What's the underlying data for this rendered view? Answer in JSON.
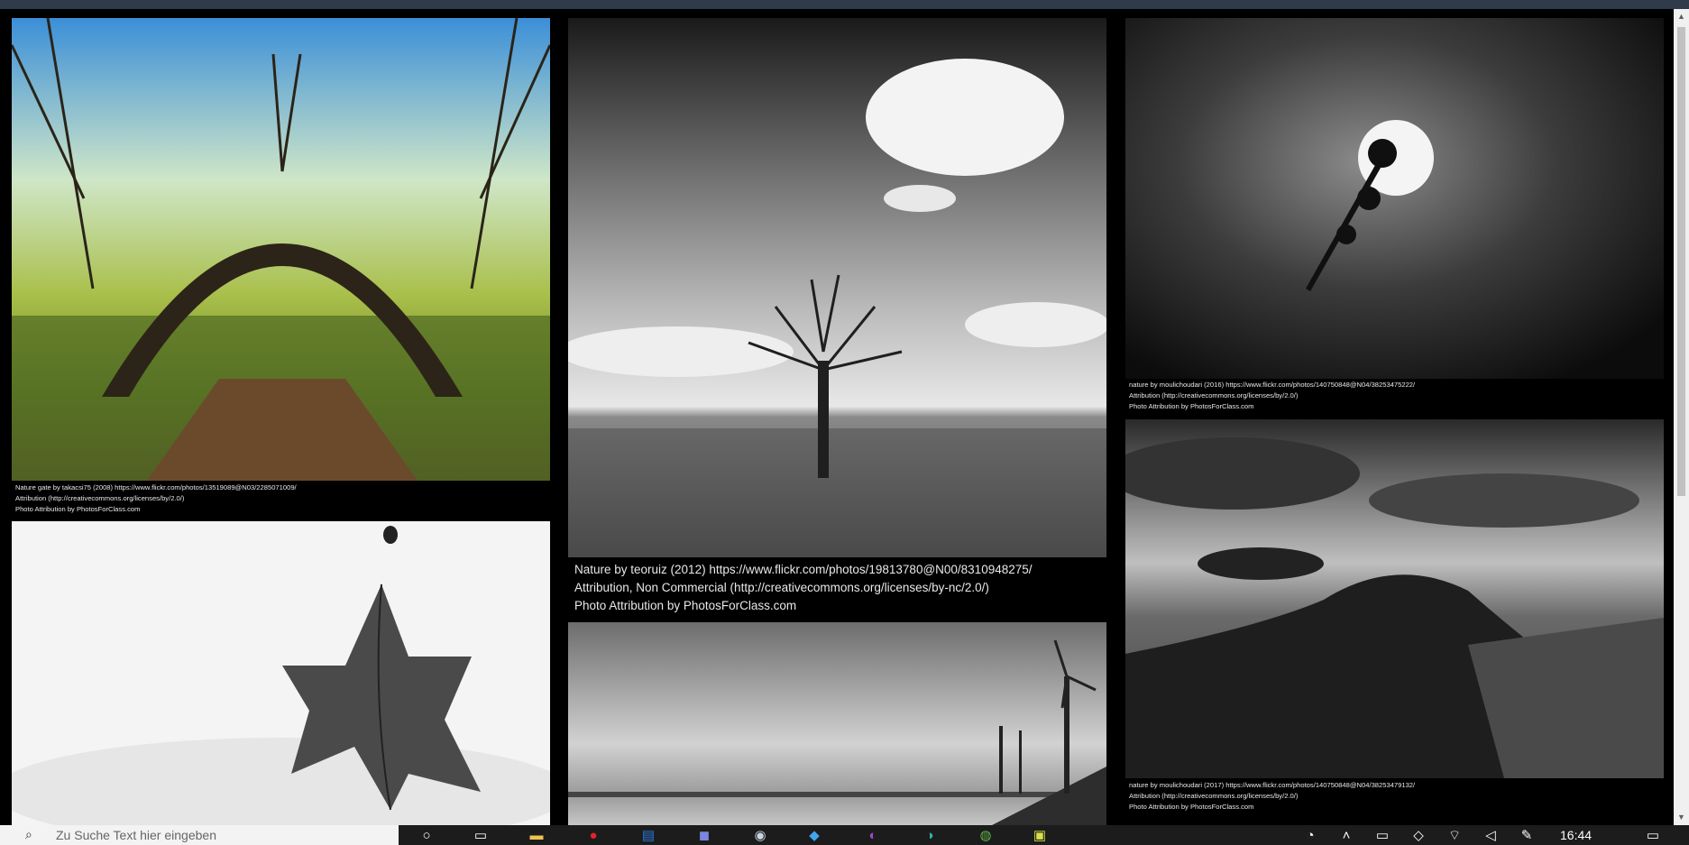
{
  "photos": [
    {
      "id": "nature-gate",
      "caption_lines": [
        "Nature gate by takacsi75 (2008) https://www.flickr.com/photos/13519089@N03/2285071009/",
        "Attribution (http://creativecommons.org/licenses/by/2.0/)",
        "Photo Attribution by PhotosForClass.com"
      ]
    },
    {
      "id": "lone-tree",
      "caption_lines": [
        "Nature by teoruiz (2012) https://www.flickr.com/photos/19813780@N00/8310948275/",
        "Attribution, Non Commercial (http://creativecommons.org/licenses/by-nc/2.0/)",
        "Photo Attribution by PhotosForClass.com"
      ]
    },
    {
      "id": "moon-flower",
      "caption_lines": [
        "nature by moulichoudari (2016) https://www.flickr.com/photos/140750848@N04/38253475222/",
        "Attribution (http://creativecommons.org/licenses/by/2.0/)",
        "Photo Attribution by PhotosForClass.com"
      ]
    },
    {
      "id": "hill-town",
      "caption_lines": [
        "nature by moulichoudari (2017) https://www.flickr.com/photos/140750848@N04/38253479132/",
        "Attribution (http://creativecommons.org/licenses/by/2.0/)",
        "Photo Attribution by PhotosForClass.com"
      ]
    },
    {
      "id": "snow-leaf"
    },
    {
      "id": "wind-turbines"
    }
  ],
  "taskbar": {
    "search_placeholder": "Zu Suche Text hier eingeben",
    "clock": "16:44",
    "icons": [
      "cortana-icon",
      "task-view-icon",
      "file-explorer-icon",
      "opera-icon",
      "calendar-icon",
      "discord-icon",
      "steam-icon",
      "twitter-icon",
      "firefox-icon",
      "edge-icon",
      "globe-icon",
      "app-icon"
    ]
  },
  "colors": {
    "page_background": "#000000",
    "taskbar": "#1c1c1c",
    "caption_text": "#e8e8e8"
  }
}
